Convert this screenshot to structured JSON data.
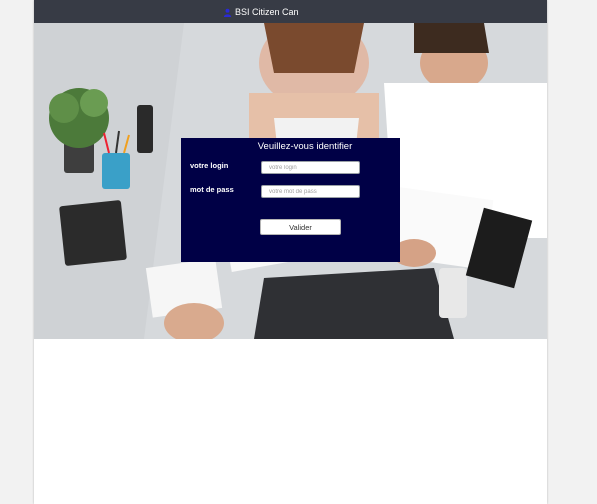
{
  "header": {
    "brand_name": "BSI Citizen Can",
    "brand_icon": "blue-person-icon"
  },
  "login": {
    "title": "Veuillez-vous identifier",
    "login_label": "votre login",
    "login_placeholder": "votre login",
    "password_label": "mot de pass",
    "password_placeholder": "votre mot de pass",
    "submit_label": "Valider"
  },
  "colors": {
    "topbar": "#373b45",
    "login_panel": "#000046",
    "brand_icon": "#2a2ad6",
    "page_background": "#f2f2f2"
  }
}
